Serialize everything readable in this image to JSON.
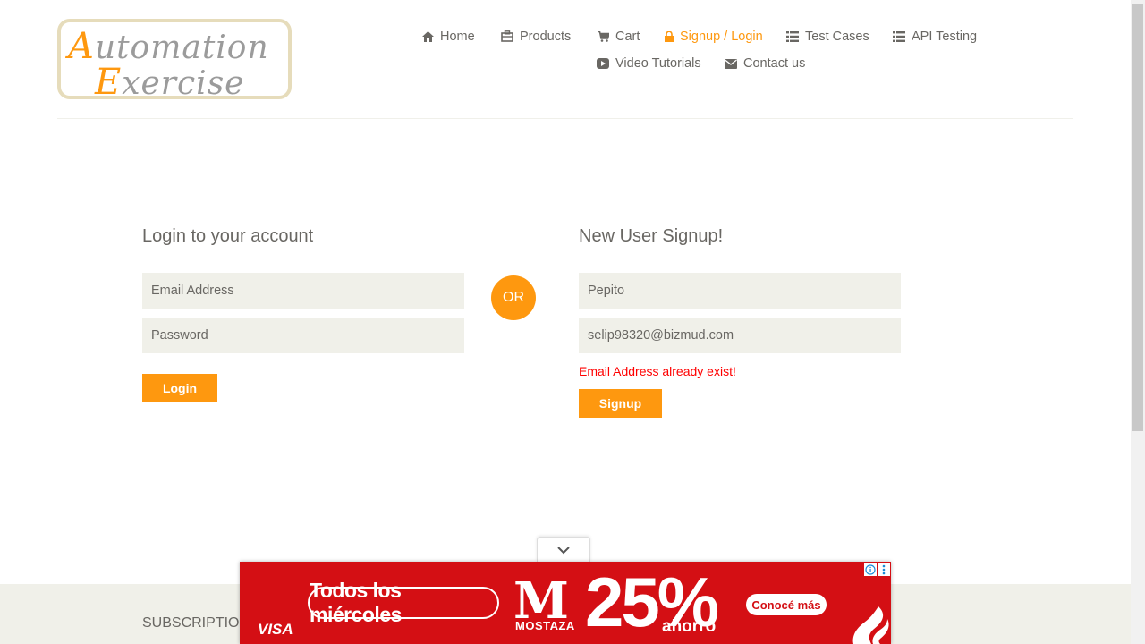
{
  "logo": {
    "line1_cap": "A",
    "line1_rest": "utomation",
    "line2_cap": "E",
    "line2_rest": "xercise"
  },
  "nav": {
    "items": [
      {
        "label": "Home",
        "icon": "home-icon"
      },
      {
        "label": "Products",
        "icon": "products-icon"
      },
      {
        "label": "Cart",
        "icon": "cart-icon"
      },
      {
        "label": "Signup / Login",
        "icon": "lock-icon",
        "active": true
      },
      {
        "label": "Test Cases",
        "icon": "list-icon"
      },
      {
        "label": "API Testing",
        "icon": "list-icon"
      },
      {
        "label": "Video Tutorials",
        "icon": "video-icon"
      },
      {
        "label": "Contact us",
        "icon": "envelope-icon"
      }
    ]
  },
  "login": {
    "title": "Login to your account",
    "email_placeholder": "Email Address",
    "password_placeholder": "Password",
    "button": "Login"
  },
  "or_label": "OR",
  "signup": {
    "title": "New User Signup!",
    "name_value": "Pepito",
    "email_value": "selip98320@bizmud.com",
    "error": "Email Address already exist!",
    "button": "Signup"
  },
  "footer": {
    "subscription_title": "SUBSCRIPTIO"
  },
  "ad": {
    "pill_text": "Todos los miércoles",
    "brand_letter": "M",
    "brand_name": "MOSTAZA",
    "discount": "25%",
    "discount_word": "ahorro",
    "cta": "Conocé más",
    "card_brand": "VISA"
  },
  "colors": {
    "accent": "#fe980f",
    "error": "#ff0000",
    "ad_red": "#d40f14",
    "input_bg": "#f0f0e9"
  }
}
